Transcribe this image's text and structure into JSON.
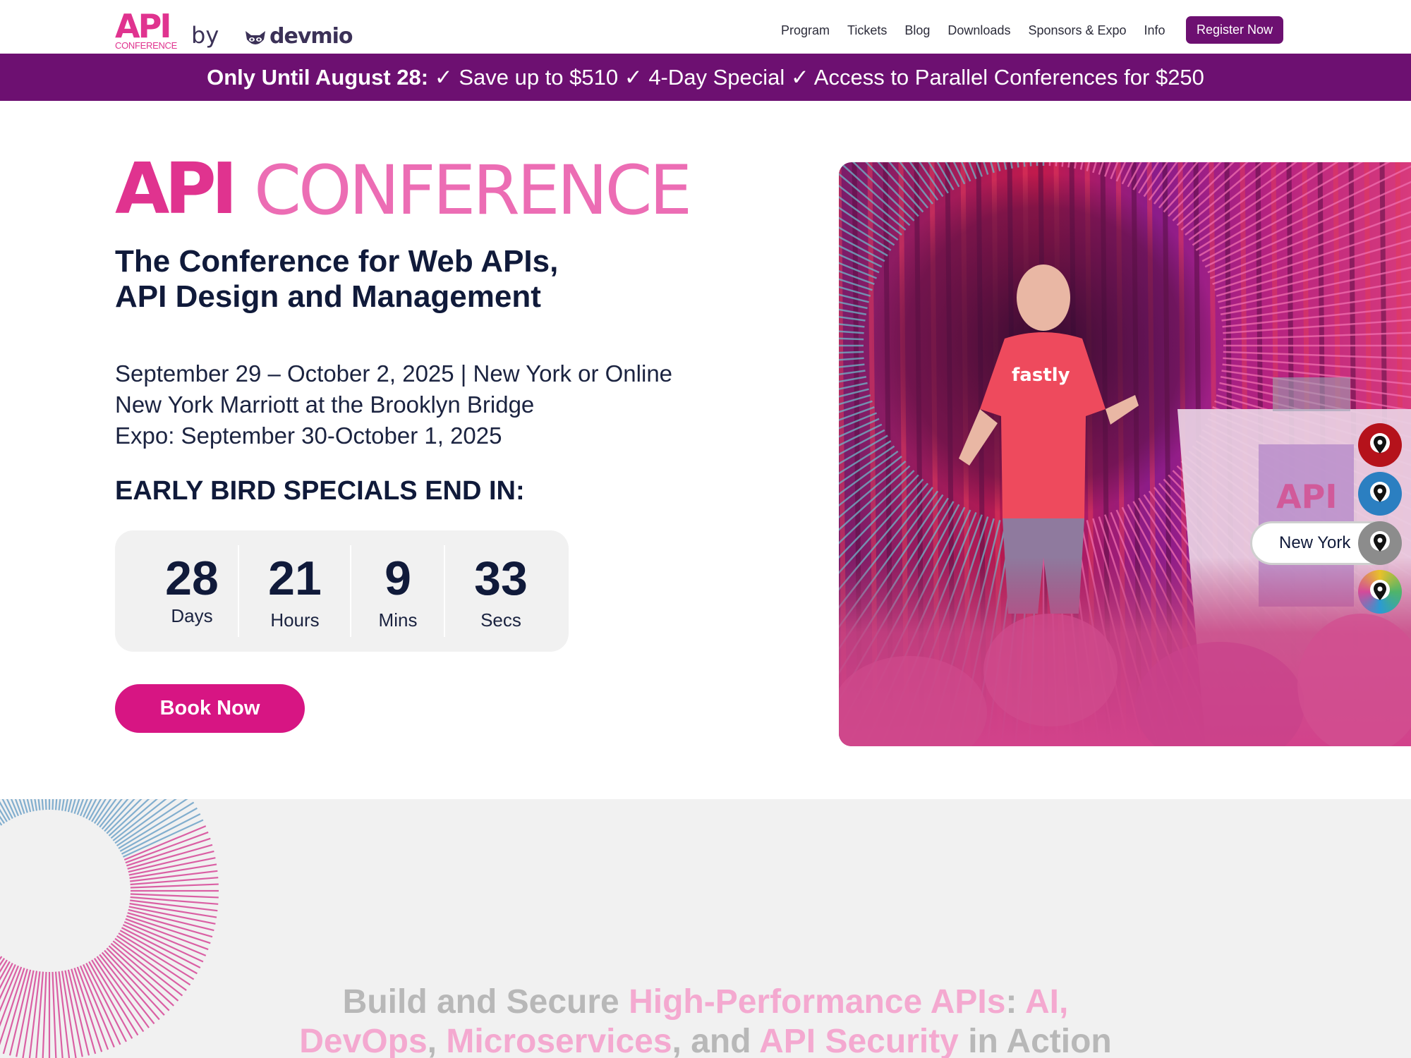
{
  "nav": {
    "logo_api": "API",
    "logo_conference": "CONFERENCE",
    "logo_by": "by",
    "logo_devmio": "devmio",
    "links": [
      "Program",
      "Tickets",
      "Blog",
      "Downloads",
      "Sponsors & Expo",
      "Info"
    ],
    "register_label": "Register Now"
  },
  "banner": {
    "lead": "Only Until August 28:",
    "items": "✓ Save up to $510  ✓ 4-Day Special ✓ Access to Parallel Conferences for $250"
  },
  "hero": {
    "logo_api": "API",
    "logo_conference": "CONFERENCE",
    "title_line1": "The Conference for Web APIs,",
    "title_line2": "API Design and Management",
    "info_line1": "September 29 – October 2, 2025 | New York or Online",
    "info_line2": "New York Marriott at the Brooklyn Bridge",
    "info_line3": "Expo: September 30-October 1, 2025",
    "early_bird_label": "EARLY BIRD SPECIALS END IN:",
    "book_label": "Book Now"
  },
  "countdown": {
    "days": "28",
    "days_label": "Days",
    "hours": "21",
    "hours_label": "Hours",
    "mins": "9",
    "mins_label": "Mins",
    "secs": "33",
    "secs_label": "Secs"
  },
  "location_switcher": {
    "active_label": "New York",
    "icons": [
      "location-pin-icon",
      "location-pin-icon",
      "location-pin-icon",
      "location-pin-icon"
    ],
    "colors": [
      "#b5121b",
      "#2b7fc1",
      "#8c8c8c",
      "#e8c12a"
    ]
  },
  "photo": {
    "shirt_text": "fastly",
    "podium_text": "API"
  },
  "lower": {
    "part1": "Build and Secure ",
    "part2": "High-Performance APIs",
    "part3": ": ",
    "part4": "AI,",
    "part5": "DevOps",
    "part6": ", ",
    "part7": "Microservices",
    "part8": ", and ",
    "part9": "API Security",
    "part10": " in Action"
  },
  "colors": {
    "brand_purple": "#6d1071",
    "brand_pink": "#d71583",
    "logo_pink": "#e0338f",
    "navy": "#101a3a"
  }
}
